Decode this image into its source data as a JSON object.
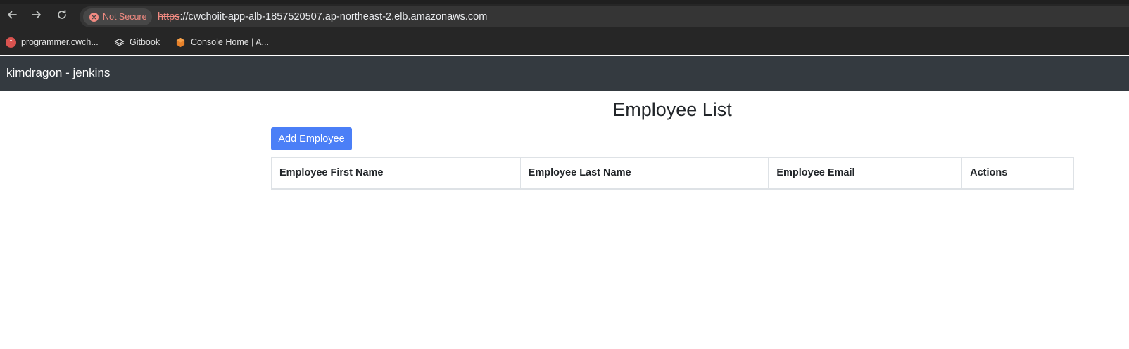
{
  "browser": {
    "security_chip": "Not Secure",
    "url_scheme": "https",
    "url_rest": "://cwchoiit-app-alb-1857520507.ap-northeast-2.elb.amazonaws.com",
    "bookmarks": [
      {
        "label": "programmer.cwch...",
        "icon": "programmer-favicon-icon"
      },
      {
        "label": "Gitbook",
        "icon": "gitbook-icon"
      },
      {
        "label": "Console Home | A...",
        "icon": "aws-console-icon"
      }
    ]
  },
  "navbar": {
    "brand": "kimdragon - jenkins",
    "bg_color": "#343a40"
  },
  "main": {
    "title": "Employee List",
    "add_button": "Add Employee",
    "add_button_color": "#4b7ff7",
    "table": {
      "columns": [
        "Employee First Name",
        "Employee Last Name",
        "Employee Email",
        "Actions"
      ],
      "rows": []
    }
  }
}
